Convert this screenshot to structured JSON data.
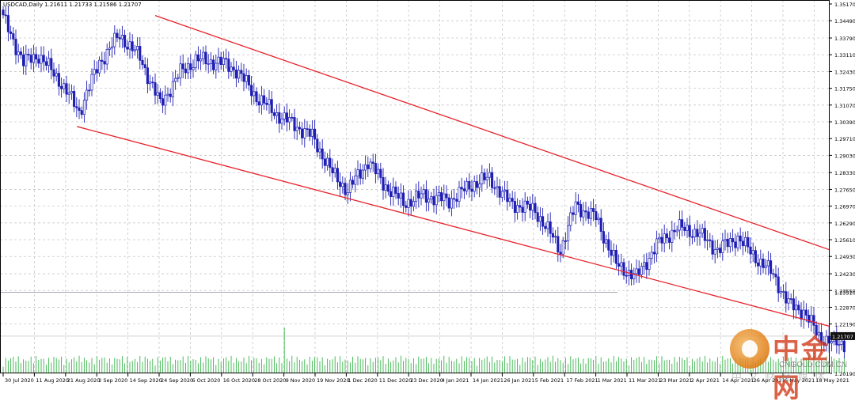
{
  "header": {
    "symbol_info": "USDCAD,Daily  1.21611 1.21733 1.21586 1.21707"
  },
  "colors": {
    "bull": "#1e1eb4",
    "bear": "#1e1eb4",
    "channel": "#e8222a",
    "volume": "#39b34a",
    "grid": "#c8c8c8",
    "price_box": "#111111"
  },
  "current_price": "1.21707",
  "partial_label": "1.23510",
  "watermark": {
    "cn": "中金网",
    "en": "CNGOLD.COM.CN",
    "sub": "中文财经媒体"
  },
  "chart_data": {
    "type": "candlestick",
    "title": "USDCAD,Daily",
    "ylim": [
      1.2019,
      1.3517
    ],
    "y_ticks": [
      "1.35170",
      "1.34490",
      "1.33790",
      "1.33110",
      "1.32430",
      "1.31750",
      "1.31070",
      "1.30390",
      "1.29710",
      "1.29030",
      "1.28330",
      "1.27650",
      "1.26970",
      "1.26290",
      "1.25610",
      "1.24930",
      "1.24230",
      "1.23550",
      "1.22870",
      "1.22190",
      "1.20190"
    ],
    "x_ticks": [
      "30 Jul 2020",
      "11 Aug 2020",
      "21 Aug 2020",
      "2 Sep 2020",
      "14 Sep 2020",
      "24 Sep 2020",
      "6 Oct 2020",
      "16 Oct 2020",
      "28 Oct 2020",
      "9 Nov 2020",
      "19 Nov 2020",
      "1 Dec 2020",
      "11 Dec 2020",
      "23 Dec 2020",
      "4 Jan 2021",
      "14 Jan 2021",
      "26 Jan 2021",
      "5 Feb 2021",
      "17 Feb 2021",
      "1 Mar 2021",
      "11 Mar 2021",
      "23 Mar 2021",
      "2 Apr 2021",
      "14 Apr 2021",
      "26 Apr 2021",
      "6 May 2021",
      "18 May 2021"
    ],
    "anchors": [
      [
        0,
        1.346
      ],
      [
        8,
        1.328
      ],
      [
        14,
        1.331
      ],
      [
        22,
        1.321
      ],
      [
        30,
        1.308
      ],
      [
        38,
        1.328
      ],
      [
        46,
        1.339
      ],
      [
        54,
        1.33
      ],
      [
        62,
        1.311
      ],
      [
        70,
        1.324
      ],
      [
        76,
        1.329
      ],
      [
        86,
        1.328
      ],
      [
        92,
        1.325
      ],
      [
        100,
        1.314
      ],
      [
        108,
        1.307
      ],
      [
        116,
        1.302
      ],
      [
        122,
        1.298
      ],
      [
        130,
        1.283
      ],
      [
        136,
        1.276
      ],
      [
        144,
        1.288
      ],
      [
        150,
        1.279
      ],
      [
        158,
        1.271
      ],
      [
        166,
        1.274
      ],
      [
        176,
        1.272
      ],
      [
        186,
        1.279
      ],
      [
        192,
        1.281
      ],
      [
        200,
        1.271
      ],
      [
        210,
        1.268
      ],
      [
        220,
        1.252
      ],
      [
        226,
        1.27
      ],
      [
        234,
        1.265
      ],
      [
        242,
        1.246
      ],
      [
        250,
        1.241
      ],
      [
        258,
        1.254
      ],
      [
        266,
        1.261
      ],
      [
        274,
        1.259
      ],
      [
        282,
        1.252
      ],
      [
        290,
        1.257
      ],
      [
        296,
        1.25
      ],
      [
        304,
        1.242
      ],
      [
        310,
        1.23
      ],
      [
        316,
        1.227
      ],
      [
        322,
        1.217
      ],
      [
        328,
        1.214
      ]
    ],
    "volume_scale": [
      0.55,
      1.0
    ],
    "channel_lines": [
      {
        "name": "upper",
        "points": [
          [
            "24 Sep 2020",
            1.347
          ],
          [
            "18 May 2021 (right edge)",
            1.252
          ]
        ]
      },
      {
        "name": "lower",
        "points": [
          [
            "1 Sep 2020",
            1.302
          ],
          [
            "18 May 2021 (right edge)",
            1.221
          ]
        ]
      }
    ]
  }
}
